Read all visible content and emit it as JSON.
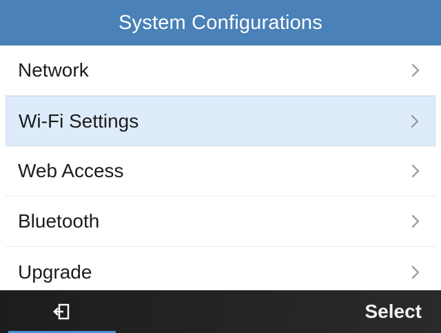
{
  "header": {
    "title": "System Configurations"
  },
  "menu": {
    "items": [
      {
        "label": "Network",
        "icon": "chevron-right-icon"
      },
      {
        "label": "Wi-Fi Settings",
        "icon": "chevron-right-icon",
        "selected": true
      },
      {
        "label": "Web Access",
        "icon": "chevron-right-icon"
      },
      {
        "label": "Bluetooth",
        "icon": "chevron-right-icon"
      },
      {
        "label": "Upgrade",
        "icon": "chevron-right-icon"
      }
    ]
  },
  "softkeys": {
    "left_icon": "exit-icon",
    "right_label": "Select"
  },
  "colors": {
    "header_bg": "#4a81b8",
    "selected_row_bg": "#ddebfa",
    "softkey_bar_bg": "#202020",
    "active_softkey_underline": "#4a90d9"
  }
}
